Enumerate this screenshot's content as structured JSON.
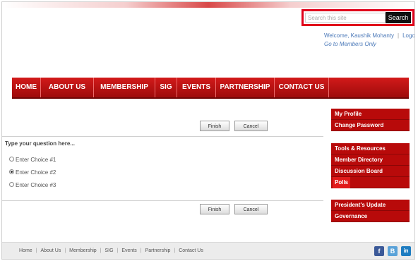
{
  "header": {
    "search_placeholder": "Search this site",
    "search_button": "Search",
    "welcome_text": "Welcome, Kaushik Mohanty",
    "logout": "Logout",
    "members_link": "Go to Members Only"
  },
  "nav": {
    "items": [
      "HOME",
      "ABOUT US",
      "MEMBERSHIP",
      "SIG",
      "EVENTS",
      "PARTNERSHIP",
      "CONTACT US"
    ]
  },
  "poll": {
    "finish_label": "Finish",
    "cancel_label": "Cancel",
    "question": "Type your question here...",
    "choices": [
      "Enter Choice #1",
      "Enter Choice #2",
      "Enter Choice #3"
    ],
    "selected_choice_index": 1
  },
  "sidebar": {
    "group1": [
      "My Profile",
      "Change Password"
    ],
    "group2": [
      "Tools & Resources",
      "Member Directory",
      "Discussion Board",
      "Polls"
    ],
    "group3": [
      "President's Update",
      "Governance"
    ]
  },
  "footer": {
    "links": [
      "Home",
      "About Us",
      "Membership",
      "SIG",
      "Events",
      "Partnership",
      "Contact Us"
    ],
    "social": [
      {
        "name": "facebook-icon",
        "glyph": "f",
        "color": "#3b5998"
      },
      {
        "name": "blogger-icon",
        "glyph": "B",
        "color": "#5aa2d8"
      },
      {
        "name": "linkedin-icon",
        "glyph": "in",
        "color": "#1f7dc1"
      }
    ]
  },
  "colors": {
    "brand_red": "#c40f0f",
    "link_blue": "#4a78b8"
  }
}
